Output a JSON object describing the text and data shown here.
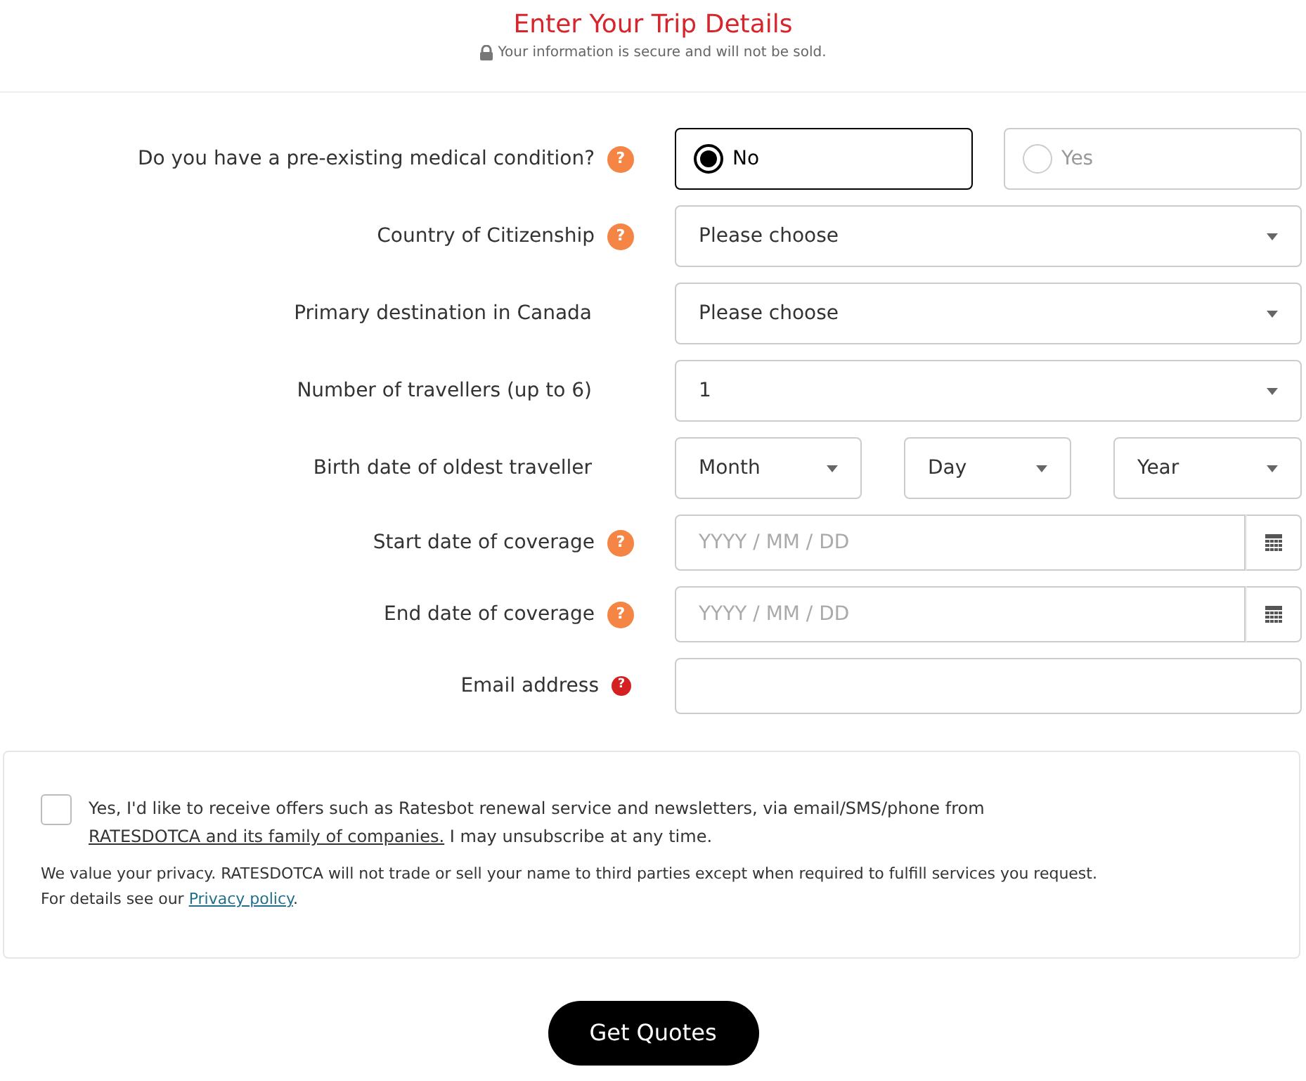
{
  "header": {
    "title": "Enter Your Trip Details",
    "subtitle": "Your information is secure and will not be sold."
  },
  "rows": [
    {
      "kind": "radio",
      "label": "Do you have a pre-existing medical condition?",
      "help": {
        "kind": "info",
        "text": "?"
      },
      "options": [
        {
          "label": "No",
          "selected": true
        },
        {
          "label": "Yes",
          "selected": false
        }
      ]
    },
    {
      "kind": "select",
      "label": "Country of Citizenship",
      "help": {
        "kind": "info",
        "text": "?"
      },
      "value": "Please choose"
    },
    {
      "kind": "select",
      "label": "Primary destination in Canada",
      "value": "Please choose"
    },
    {
      "kind": "select",
      "label": "Number of travellers (up to 6)",
      "value": "1"
    },
    {
      "kind": "selects",
      "label": "Birth date of oldest traveller",
      "values": [
        "Month",
        "Day",
        "Year"
      ]
    },
    {
      "kind": "date",
      "label": "Start date of coverage",
      "help": {
        "kind": "info",
        "text": "?"
      },
      "placeholder": "YYYY / MM / DD"
    },
    {
      "kind": "date",
      "label": "End date of coverage",
      "help": {
        "kind": "info",
        "text": "?"
      },
      "placeholder": "YYYY / MM / DD"
    },
    {
      "kind": "text",
      "label": "Email address",
      "help": {
        "kind": "required",
        "text": "?"
      }
    }
  ],
  "consent": {
    "checked": false,
    "before": "Yes, I'd like to receive offers such as Ratesbot renewal service and newsletters, via email/SMS/phone from ",
    "link": "RATESDOTCA and its family of companies.",
    "after": " I may unsubscribe at any time."
  },
  "privacy": {
    "before": "We value your privacy. RATESDOTCA will not trade or sell your name to third parties except when required to fulfill services you request.",
    "line2": "For details see our ",
    "link": "Privacy policy",
    "after": "."
  },
  "submit": "Get Quotes"
}
